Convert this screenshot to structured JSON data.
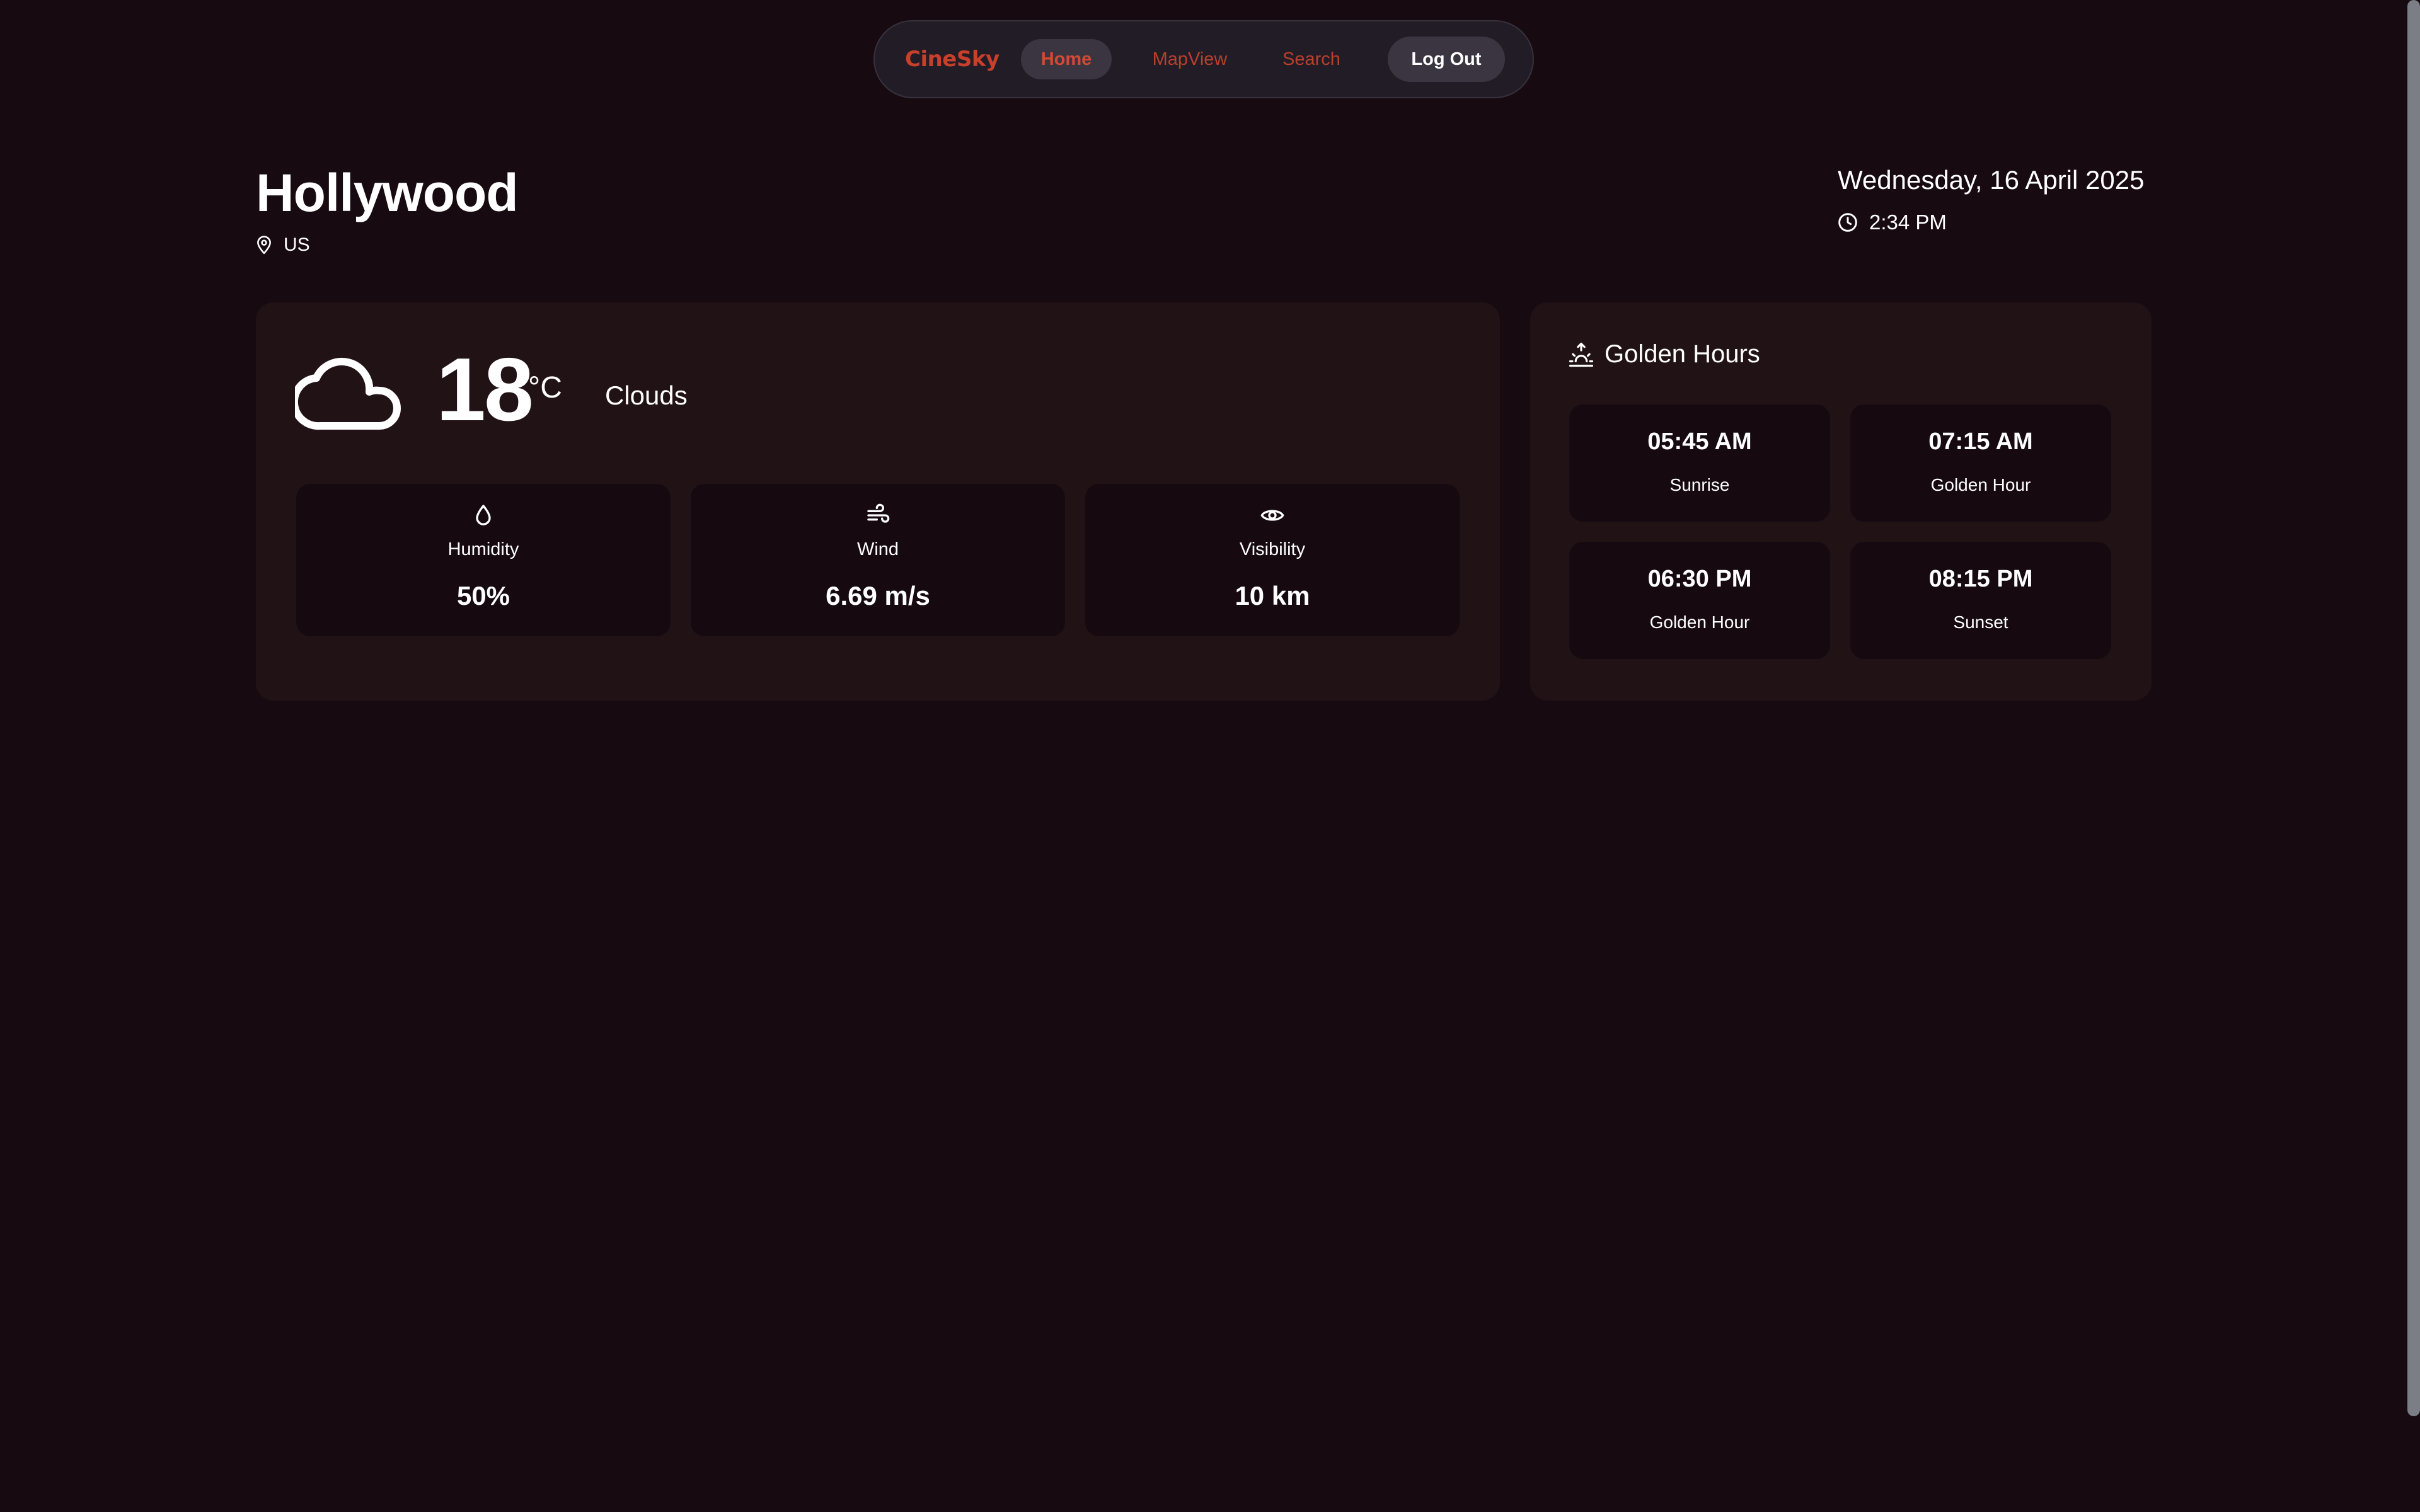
{
  "nav": {
    "brand": "CineSky",
    "links": [
      {
        "label": "Home",
        "active": true
      },
      {
        "label": "MapView",
        "active": false
      },
      {
        "label": "Search",
        "active": false
      }
    ],
    "logout_label": "Log Out"
  },
  "location": {
    "city": "Hollywood",
    "country": "US",
    "date": "Wednesday, 16 April 2025",
    "time": "2:34 PM"
  },
  "weather": {
    "icon": "cloud-icon",
    "temperature": "18",
    "unit": "°C",
    "condition": "Clouds",
    "stats": [
      {
        "icon": "droplet-icon",
        "label": "Humidity",
        "value": "50%"
      },
      {
        "icon": "wind-icon",
        "label": "Wind",
        "value": "6.69 m/s"
      },
      {
        "icon": "eye-icon",
        "label": "Visibility",
        "value": "10 km"
      }
    ]
  },
  "golden_hours": {
    "title": "Golden Hours",
    "icon": "sunrise-icon",
    "tiles": [
      {
        "time": "05:45 AM",
        "label": "Sunrise"
      },
      {
        "time": "07:15 AM",
        "label": "Golden Hour"
      },
      {
        "time": "06:30 PM",
        "label": "Golden Hour"
      },
      {
        "time": "08:15 PM",
        "label": "Sunset"
      }
    ]
  },
  "colors": {
    "background": "#170a10",
    "accent": "#c8402a",
    "card": "#211216",
    "tile": "#160a10",
    "nav": "#211c26"
  }
}
